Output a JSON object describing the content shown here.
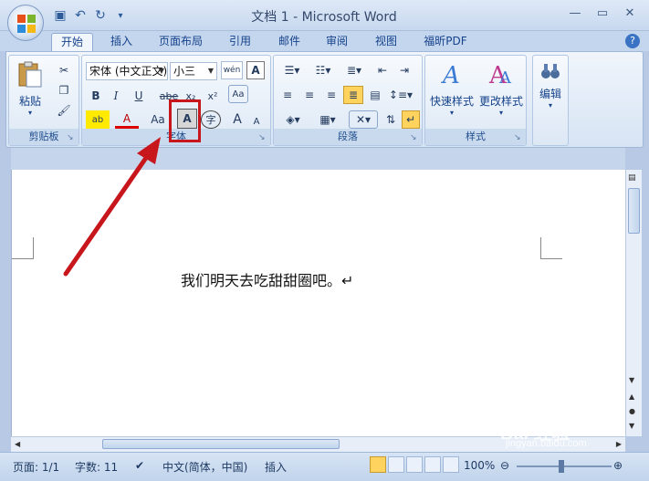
{
  "window": {
    "title": "文档 1 - Microsoft Word"
  },
  "tabs": [
    "开始",
    "插入",
    "页面布局",
    "引用",
    "邮件",
    "审阅",
    "视图",
    "福昕PDF"
  ],
  "clipboard": {
    "paste": "粘贴",
    "group": "剪贴板"
  },
  "font": {
    "name": "宋体 (中文正文)",
    "size": "小三",
    "group": "字体",
    "bold": "B",
    "italic": "I",
    "underline": "U",
    "strike": "abe",
    "sub": "x₂",
    "sup": "x²",
    "case": "Aa",
    "border_a": "A",
    "enclose": "字",
    "grow": "A",
    "shrink": "A",
    "phonetic": "wén",
    "clear": "A"
  },
  "paragraph": {
    "group": "段落"
  },
  "styles": {
    "quick": "快速样式",
    "change": "更改样式",
    "group": "样式"
  },
  "editing": {
    "label": "编辑"
  },
  "document": {
    "text": "我们明天去吃甜甜圈吧。↵"
  },
  "status": {
    "page": "页面: 1/1",
    "words": "字数: 11",
    "language": "中文(简体，中国)",
    "mode": "插入",
    "zoom": "100%"
  },
  "watermark": {
    "brand": "Bai 经验",
    "url": "jingyan.baidu.com"
  },
  "colors": {
    "accent": "#c8161d",
    "ribbon": "#d7e4f4",
    "titlebar": "#dfe9f7"
  }
}
